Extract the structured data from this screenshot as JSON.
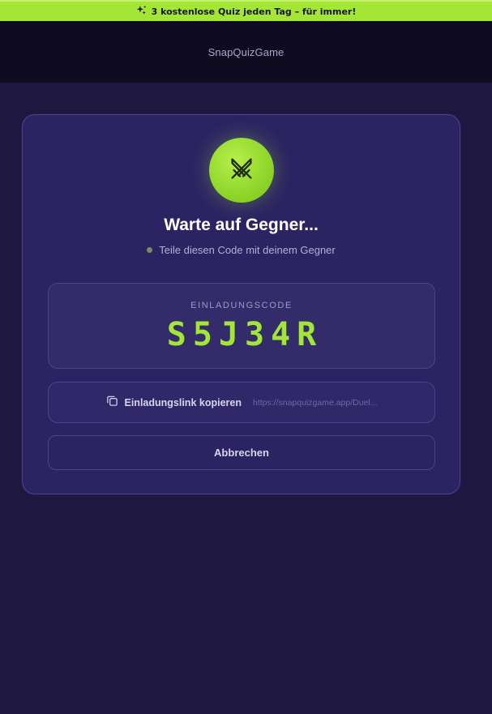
{
  "banner": {
    "icon": "sparkle-icon",
    "text": "3 kostenlose Quiz jeden Tag – für immer!",
    "color": "#a3e635"
  },
  "header": {
    "brand": "SnapQuizGame"
  },
  "lobby": {
    "badge_icon": "crossed-swords-icon",
    "title": "Warte auf Gegner...",
    "subtitle": "Teile diesen Code mit deinem Gegner",
    "status_dot_color": "#7d8a63",
    "code_label": "EINLADUNGSCODE",
    "code": "S5J34R",
    "copy_icon": "copy-icon",
    "copy_label": "Einladungslink kopieren",
    "copy_url": "https://snapquizgame.app/Duel...",
    "cancel_label": "Abbrechen"
  },
  "colors": {
    "accent": "#a3e635",
    "background": "#1e1841",
    "card": "#2c2462",
    "topbar": "#0f0c21"
  }
}
